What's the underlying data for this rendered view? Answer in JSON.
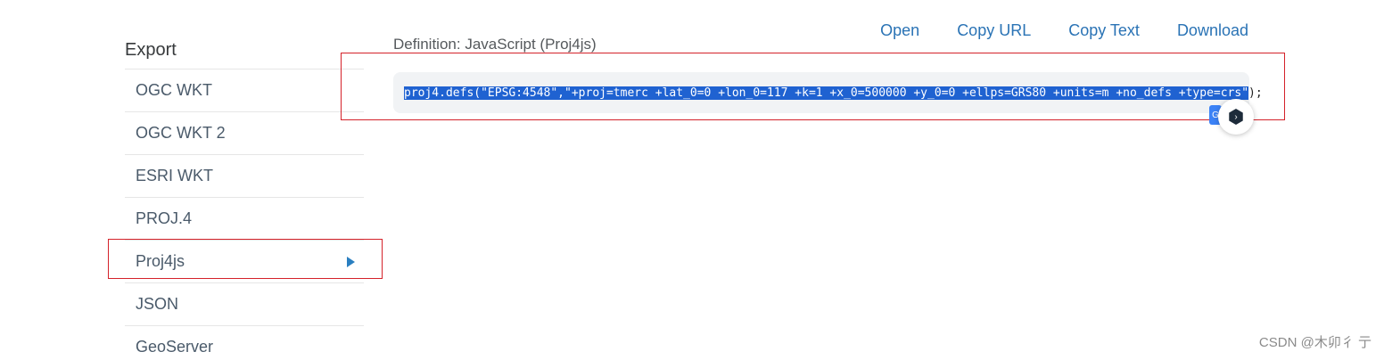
{
  "sidebar": {
    "title": "Export",
    "items": [
      {
        "label": "OGC WKT"
      },
      {
        "label": "OGC WKT 2"
      },
      {
        "label": "ESRI WKT"
      },
      {
        "label": "PROJ.4"
      },
      {
        "label": "Proj4js",
        "selected": true
      },
      {
        "label": "JSON"
      },
      {
        "label": "GeoServer"
      }
    ]
  },
  "actions": {
    "open": "Open",
    "copy_url": "Copy URL",
    "copy_text": "Copy Text",
    "download": "Download"
  },
  "definition": {
    "label": "Definition: JavaScript (Proj4js)",
    "code_selected": "proj4.defs(\"EPSG:4548\",\"+proj=tmerc +lat_0=0 +lon_0=117 +k=1 +x_0=500000 +y_0=0 +ellps=GRS80 +units=m +no_defs +type=crs\"",
    "code_rest": ");"
  },
  "widget": {
    "badge_text": "G",
    "icon": "deepl-hex-icon"
  },
  "watermark": "CSDN @木卯彳 亍",
  "colors": {
    "link": "#2a73b5",
    "selection": "#1f62d1",
    "highlight_border": "#d4222a",
    "arrow": "#2a7fc0"
  }
}
